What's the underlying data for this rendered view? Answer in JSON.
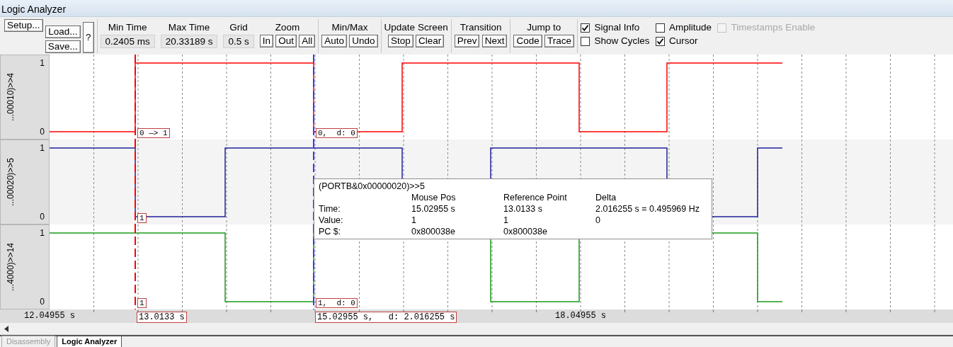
{
  "window": {
    "title": "Logic Analyzer"
  },
  "toolbar": {
    "groups": [
      {
        "kind": "file",
        "buttons": [
          "Setup...",
          "Load...",
          "Save...",
          "?"
        ]
      },
      {
        "kind": "readout",
        "title": "Min Time",
        "value": "0.2405 ms"
      },
      {
        "kind": "readout",
        "title": "Max Time",
        "value": "20.33189 s"
      },
      {
        "kind": "readout",
        "title": "Grid",
        "value": "0.5 s"
      },
      {
        "kind": "buttons",
        "title": "Zoom",
        "buttons": [
          "In",
          "Out",
          "All"
        ]
      },
      {
        "kind": "buttons",
        "title": "Min/Max",
        "buttons": [
          "Auto",
          "Undo"
        ]
      },
      {
        "kind": "buttons",
        "title": "Update Screen",
        "buttons": [
          "Stop",
          "Clear"
        ]
      },
      {
        "kind": "buttons",
        "title": "Transition",
        "buttons": [
          "Prev",
          "Next"
        ]
      },
      {
        "kind": "buttons",
        "title": "Jump to",
        "buttons": [
          "Code",
          "Trace"
        ]
      }
    ],
    "checkboxes": [
      {
        "label": "Signal Info",
        "checked": true,
        "disabled": false
      },
      {
        "label": "Amplitude",
        "checked": false,
        "disabled": false
      },
      {
        "label": "Timestamps Enable",
        "checked": false,
        "disabled": true
      },
      {
        "label": "Show Cycles",
        "checked": false,
        "disabled": false
      },
      {
        "label": "Cursor",
        "checked": true,
        "disabled": false
      }
    ]
  },
  "tracks": [
    {
      "name": "...00010)>>4",
      "color": "#ff0000",
      "y_labels": [
        "1",
        "0"
      ],
      "cursor_labels": [
        {
          "kind": "reference",
          "text": "0 —> 1"
        },
        {
          "kind": "mouse",
          "text": "0,  d: 0"
        }
      ]
    },
    {
      "name": "...00020)>>5",
      "color": "#20209c",
      "y_labels": [
        "1",
        "0"
      ],
      "cursor_labels": [
        {
          "kind": "reference",
          "text": "1"
        }
      ]
    },
    {
      "name": "...4000)>>14",
      "color": "#1a9a1a",
      "y_labels": [
        "1",
        "0"
      ],
      "cursor_labels": [
        {
          "kind": "reference",
          "text": "1"
        },
        {
          "kind": "mouse",
          "text": "1,  d: 0"
        }
      ]
    }
  ],
  "time_axis": {
    "labels": [
      {
        "kind": "tick",
        "text": "12.04955 s"
      },
      {
        "kind": "reference",
        "text": "13.0133 s"
      },
      {
        "kind": "mouse",
        "text": "15.02955 s,   d: 2.016255 s"
      },
      {
        "kind": "tick",
        "text": "18.04955 s"
      }
    ]
  },
  "tooltip": {
    "title": "(PORTB&0x00000020)>>5",
    "headers": [
      "Mouse Pos",
      "Reference Point",
      "Delta"
    ],
    "rows": [
      {
        "label": "Time:",
        "cells": [
          "15.02955 s",
          "13.0133 s",
          "2.016255 s = 0.495969 Hz"
        ]
      },
      {
        "label": "Value:",
        "cells": [
          "1",
          "1",
          "0"
        ]
      },
      {
        "label": "PC $:",
        "cells": [
          "0x800038e",
          "0x800038e"
        ]
      }
    ]
  },
  "bottom_tabs": [
    {
      "label": "Disassembly",
      "selected": false
    },
    {
      "label": "Logic Analyzer",
      "selected": true
    }
  ]
}
